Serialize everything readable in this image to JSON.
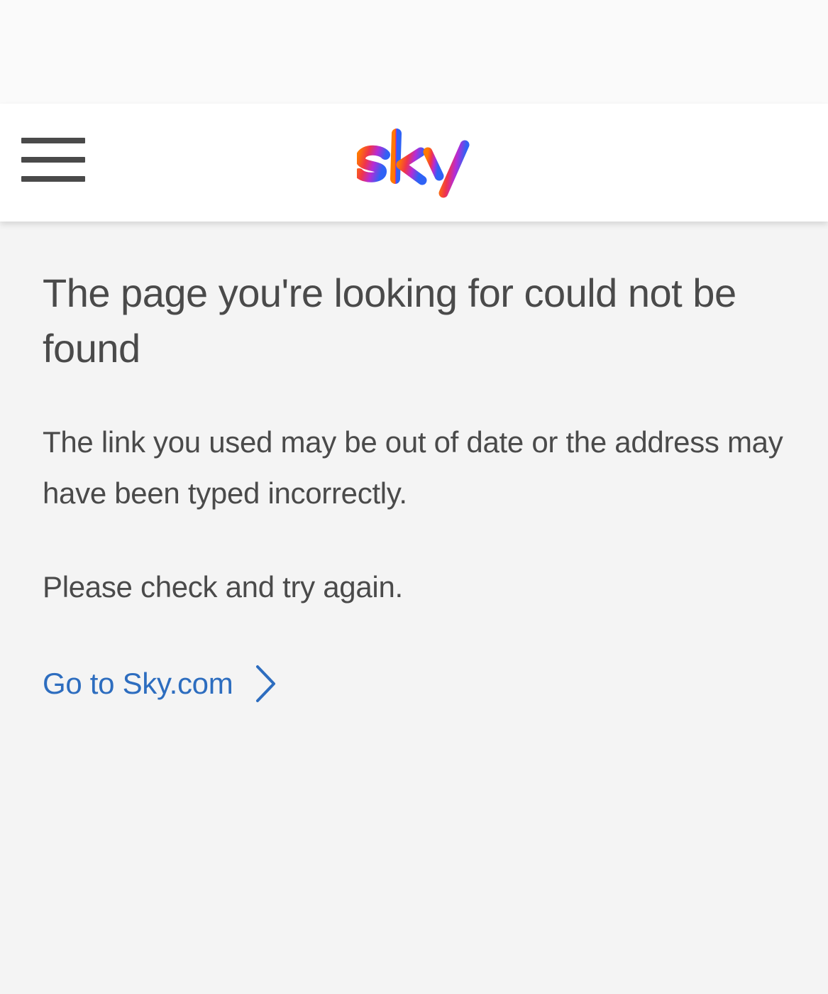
{
  "header": {
    "menu_label": "Menu",
    "logo_text": "sky"
  },
  "main": {
    "heading": "The page you're looking for could not be found",
    "paragraph_1": "The link you used may be out of date or the address may have been typed incorrectly.",
    "paragraph_2": "Please check and try again.",
    "link_label": "Go to Sky.com",
    "link_icon": "chevron-right-icon"
  },
  "colors": {
    "background": "#f4f4f4",
    "header_background": "#ffffff",
    "text": "#4a4a4a",
    "link": "#2d6dbf",
    "logo_gradient": [
      "#ff6a00",
      "#e9334d",
      "#b42ad8",
      "#3a5bf2"
    ]
  }
}
